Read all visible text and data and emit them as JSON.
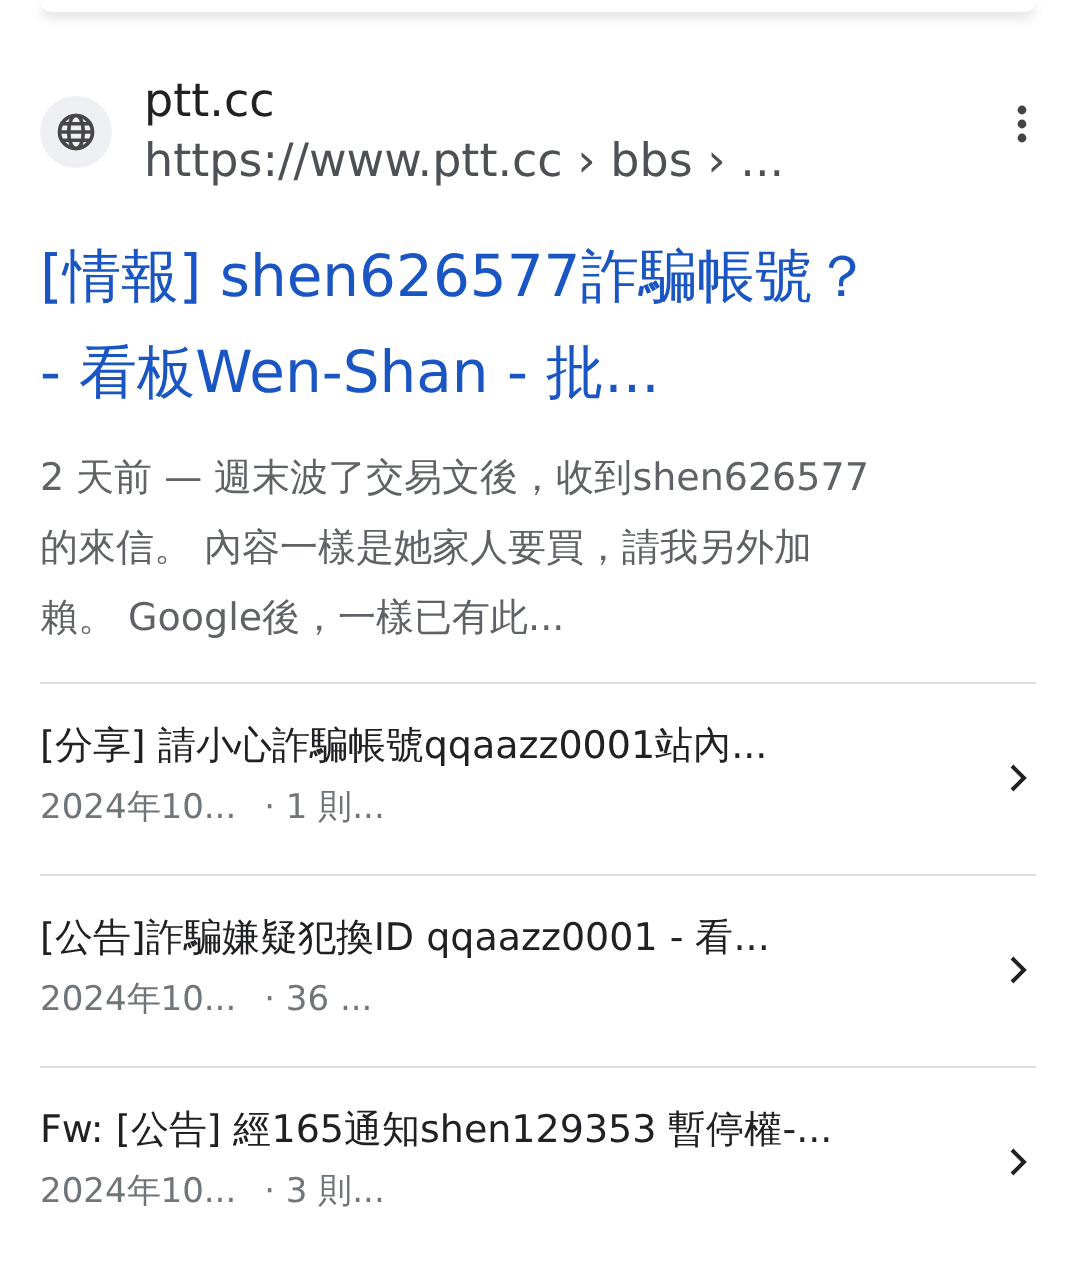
{
  "result": {
    "site_name": "ptt.cc",
    "url": "https://www.ptt.cc › bbs › ...",
    "title": "[情報] shen626577詐騙帳號？ - 看板Wen-Shan - 批...",
    "snippet": "2 天前 — 週末波了交易文後，收到shen626577的來信。 內容一樣是她家人要買，請我另外加賴。 Google後，一樣已有此...",
    "sub_results": [
      {
        "title": "[分享] 請小心詐騙帳號qqaazz0001站內...",
        "date": "2024年10...",
        "meta": "· 1 則..."
      },
      {
        "title": "[公告]詐騙嫌疑犯換ID qqaazz0001 - 看...",
        "date": "2024年10...",
        "meta": "· 36 ..."
      },
      {
        "title": "Fw: [公告] 經165通知shen129353 暫停權-...",
        "date": "2024年10...",
        "meta": "· 3 則..."
      }
    ]
  }
}
